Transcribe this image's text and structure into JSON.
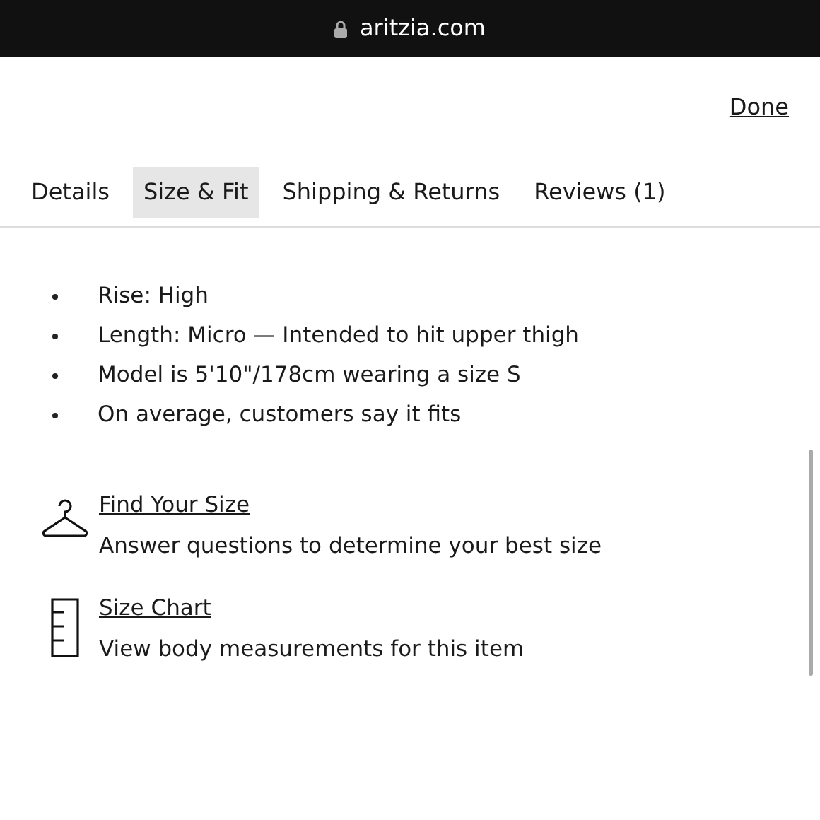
{
  "address_bar": {
    "url": "aritzia.com"
  },
  "done_link": "Done",
  "tabs": [
    {
      "label": "Details",
      "selected": false
    },
    {
      "label": "Size & Fit",
      "selected": true
    },
    {
      "label": "Shipping & Returns",
      "selected": false
    },
    {
      "label": "Reviews (1)",
      "selected": false
    }
  ],
  "fit_details": [
    "Rise: High",
    "Length: Micro — Intended to hit upper thigh",
    "Model is 5'10\"/178cm wearing a size S",
    "On average, customers say it fits"
  ],
  "size_tools": [
    {
      "kind": "hanger",
      "link": "Find Your Size",
      "description": "Answer questions to determine your best size"
    },
    {
      "kind": "ruler",
      "link": "Size Chart",
      "description": "View body measurements for this item"
    }
  ]
}
